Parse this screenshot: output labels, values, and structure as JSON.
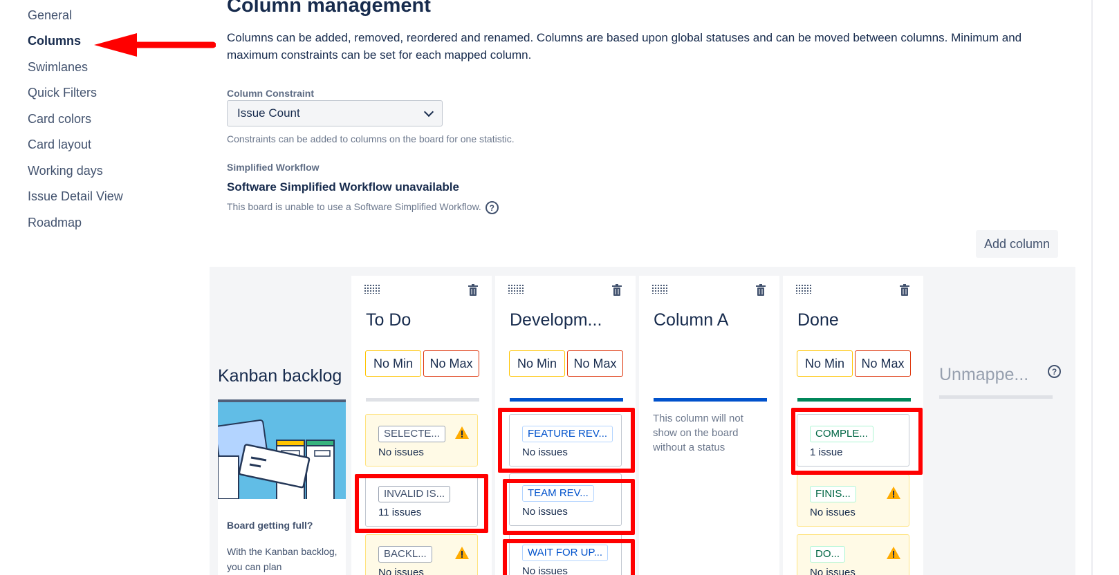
{
  "sidebar": {
    "items": [
      {
        "label": "General",
        "active": false
      },
      {
        "label": "Columns",
        "active": true
      },
      {
        "label": "Swimlanes",
        "active": false
      },
      {
        "label": "Quick Filters",
        "active": false
      },
      {
        "label": "Card colors",
        "active": false
      },
      {
        "label": "Card layout",
        "active": false
      },
      {
        "label": "Working days",
        "active": false
      },
      {
        "label": "Issue Detail View",
        "active": false
      },
      {
        "label": "Roadmap",
        "active": false
      }
    ]
  },
  "page": {
    "title": "Column management",
    "intro": "Columns can be added, removed, reordered and renamed. Columns are based upon global statuses and can be moved between columns. Minimum and maximum constraints can be set for each mapped column."
  },
  "constraint": {
    "label": "Column Constraint",
    "selected": "Issue Count",
    "help": "Constraints can be added to columns on the board for one statistic."
  },
  "workflow": {
    "label": "Simplified Workflow",
    "title": "Software Simplified Workflow unavailable",
    "help": "This board is unable to use a Software Simplified Workflow."
  },
  "add_column_label": "Add column",
  "backlog": {
    "title": "Kanban backlog",
    "card_title": "Board getting full?",
    "card_text": "With the Kanban backlog, you can plan"
  },
  "columns": [
    {
      "name": "To Do",
      "min_label": "No Min",
      "max_label": "No Max",
      "statuses": [
        {
          "label": "SELECTE...",
          "count": "No issues",
          "warning": true
        },
        {
          "label": "INVALID IS...",
          "count": "11 issues",
          "warning": false
        },
        {
          "label": "BACKL...",
          "count": "No issues",
          "warning": true
        }
      ]
    },
    {
      "name": "Developm...",
      "min_label": "No Min",
      "max_label": "No Max",
      "statuses": [
        {
          "label": "FEATURE REV...",
          "count": "No issues",
          "warning": false
        },
        {
          "label": "TEAM REV...",
          "count": "No issues",
          "warning": false
        },
        {
          "label": "WAIT FOR UP...",
          "count": "No issues",
          "warning": false
        }
      ]
    },
    {
      "name": "Column A",
      "note": "This column will not show on the board without a status"
    },
    {
      "name": "Done",
      "min_label": "No Min",
      "max_label": "No Max",
      "statuses": [
        {
          "label": "COMPLE...",
          "count": "1 issue",
          "warning": false
        },
        {
          "label": "FINIS...",
          "count": "No issues",
          "warning": true
        },
        {
          "label": "DO...",
          "count": "No issues",
          "warning": true
        }
      ]
    }
  ],
  "unmapped": {
    "title": "Unmappe..."
  },
  "colors": {
    "annotation_red": "#ff0000",
    "status_blue": "#0052cc",
    "status_green": "#00875a",
    "status_grey": "#dfe1e6",
    "warning_yellow": "#ffab00"
  }
}
